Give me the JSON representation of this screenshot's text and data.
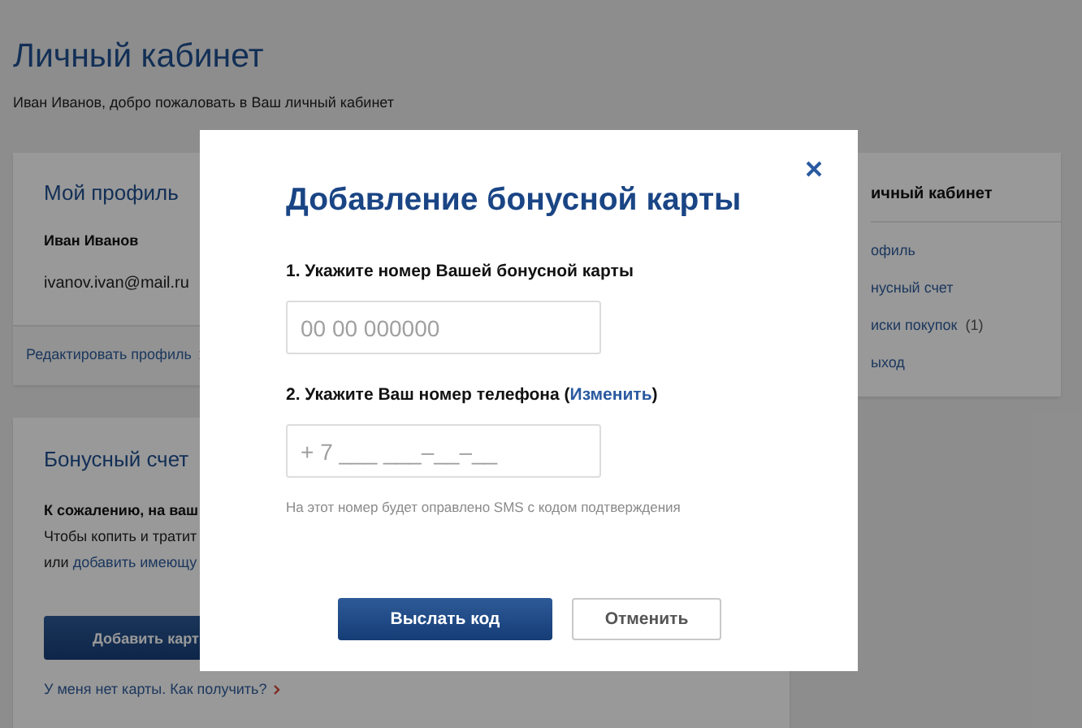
{
  "page": {
    "title": "Личный кабинет",
    "welcome": "Иван Иванов, добро пожаловать в Ваш личный кабинет"
  },
  "profile_card": {
    "title": "Мой профиль",
    "name": "Иван Иванов",
    "email": "ivanov.ivan@mail.ru",
    "edit_link": "Редактировать профиль"
  },
  "bonus_card": {
    "title": "Бонусный счет",
    "notice": "К сожалению, на ваш",
    "text": "Чтобы копить и тратит",
    "text_prefix": "или",
    "link": "добавить имеющу",
    "button": "Добавить карт",
    "no_card_link": "У меня нет карты. Как получить?"
  },
  "sidebar": {
    "title": "ичный кабинет",
    "items": [
      {
        "label": "офиль"
      },
      {
        "label": "нусный счет"
      },
      {
        "label": "иски покупок",
        "count": "(1)"
      },
      {
        "label": "ыход"
      }
    ]
  },
  "modal": {
    "title": "Добавление бонусной карты",
    "step_1": "1. Укажите номер Вашей бонусной карты",
    "card_field": {
      "placeholder": "00 00 000000"
    },
    "step_2": "2. Укажите Ваш номер телефона (",
    "step_2_link": "Изменить",
    "step_2_end": ")",
    "phone_field": {
      "placeholder": "+ 7 ___ ___–__–__"
    },
    "hint": "На этот номер будет оправлено SMS с кодом подтверждения",
    "buttons": [
      {
        "label": "Выслать код",
        "kind": "primary"
      },
      {
        "label": "Отменить",
        "kind": "secondary"
      }
    ]
  }
}
